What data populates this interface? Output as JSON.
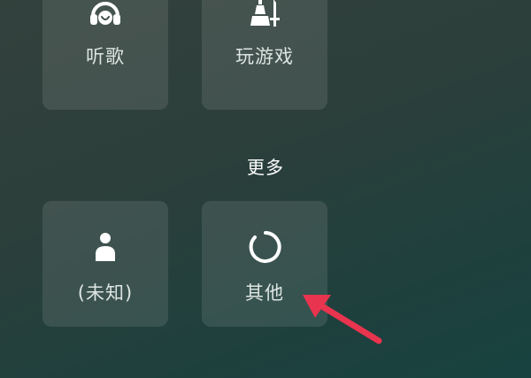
{
  "categories_top": [
    {
      "label": "听歌",
      "icon": "headphone-person-icon"
    },
    {
      "label": "玩游戏",
      "icon": "game-chess-sword-icon"
    }
  ],
  "more_section": {
    "title": "更多",
    "items": [
      {
        "label": "(未知)",
        "icon": "person-icon"
      },
      {
        "label": "其他",
        "icon": "ring-loading-icon"
      }
    ]
  },
  "colors": {
    "tile_background": "rgba(255,255,255,0.10)",
    "icon": "#ffffff",
    "arrow": "#e8344e"
  }
}
